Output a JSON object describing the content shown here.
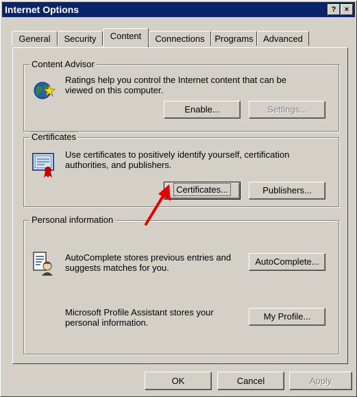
{
  "window": {
    "title": "Internet Options",
    "help_glyph": "?",
    "close_glyph": "×"
  },
  "tabs": [
    {
      "label": "General"
    },
    {
      "label": "Security"
    },
    {
      "label": "Content"
    },
    {
      "label": "Connections"
    },
    {
      "label": "Programs"
    },
    {
      "label": "Advanced"
    }
  ],
  "content_advisor": {
    "title": "Content Advisor",
    "description": "Ratings help you control the Internet content that can be viewed on this computer.",
    "enable_label": "Enable...",
    "settings_label": "Settings..."
  },
  "certificates": {
    "title": "Certificates",
    "description": "Use certificates to positively identify yourself, certification authorities, and publishers.",
    "certificates_label": "Certificates...",
    "publishers_label": "Publishers..."
  },
  "personal_info": {
    "title": "Personal information",
    "autocomplete_text": "AutoComplete stores previous entries and suggests matches for you.",
    "autocomplete_label": "AutoComplete...",
    "profile_text": "Microsoft Profile Assistant stores your personal information.",
    "profile_label": "My Profile..."
  },
  "footer": {
    "ok_label": "OK",
    "cancel_label": "Cancel",
    "apply_label": "Apply"
  },
  "colors": {
    "titlebar": "#0a246a",
    "face": "#d4d0c8",
    "arrow": "#e00000"
  }
}
